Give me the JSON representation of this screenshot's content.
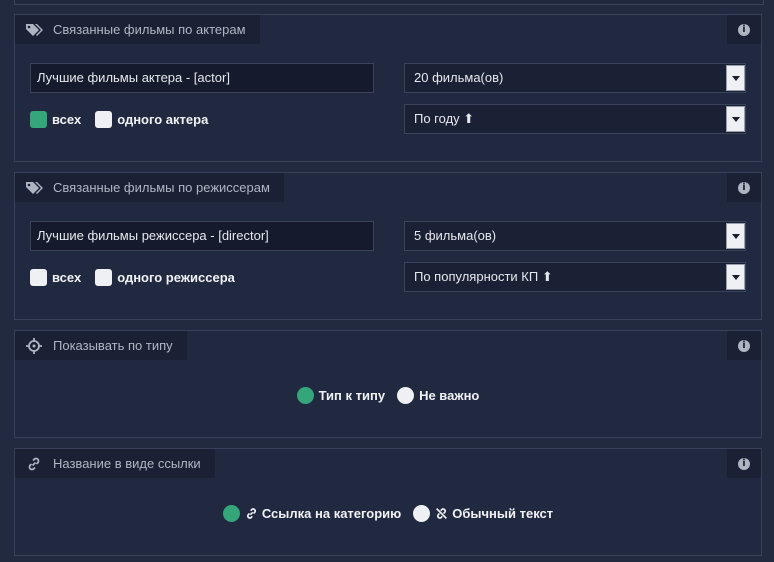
{
  "actor_panel": {
    "title": "Связанные фильмы по актерам",
    "title_input_value": "Лучшие фильмы актера - [actor]",
    "count_select": "20 фильма(ов)",
    "sort_select": "По году ⬆",
    "checkboxes": [
      {
        "label": "всех",
        "checked": true
      },
      {
        "label": "одного актера",
        "checked": false
      }
    ]
  },
  "director_panel": {
    "title": "Связанные фильмы по режиссерам",
    "title_input_value": "Лучшие фильмы режиссера - [director]",
    "count_select": "5 фильма(ов)",
    "sort_select": "По популярности КП ⬆",
    "checkboxes": [
      {
        "label": "всех",
        "checked": false
      },
      {
        "label": "одного режиссера",
        "checked": false
      }
    ]
  },
  "type_panel": {
    "title": "Показывать по типу",
    "options": [
      {
        "label": "Тип к типу",
        "selected": true
      },
      {
        "label": "Не важно",
        "selected": false
      }
    ]
  },
  "link_panel": {
    "title": "Название в виде ссылки",
    "options": [
      {
        "label": "Ссылка на категорию",
        "icon": "link-icon",
        "selected": true
      },
      {
        "label": "Обычный текст",
        "icon": "unlink-icon",
        "selected": false
      }
    ]
  },
  "colors": {
    "accent": "#35a57a",
    "background": "#222a3f",
    "panel_header": "#1a2134"
  }
}
